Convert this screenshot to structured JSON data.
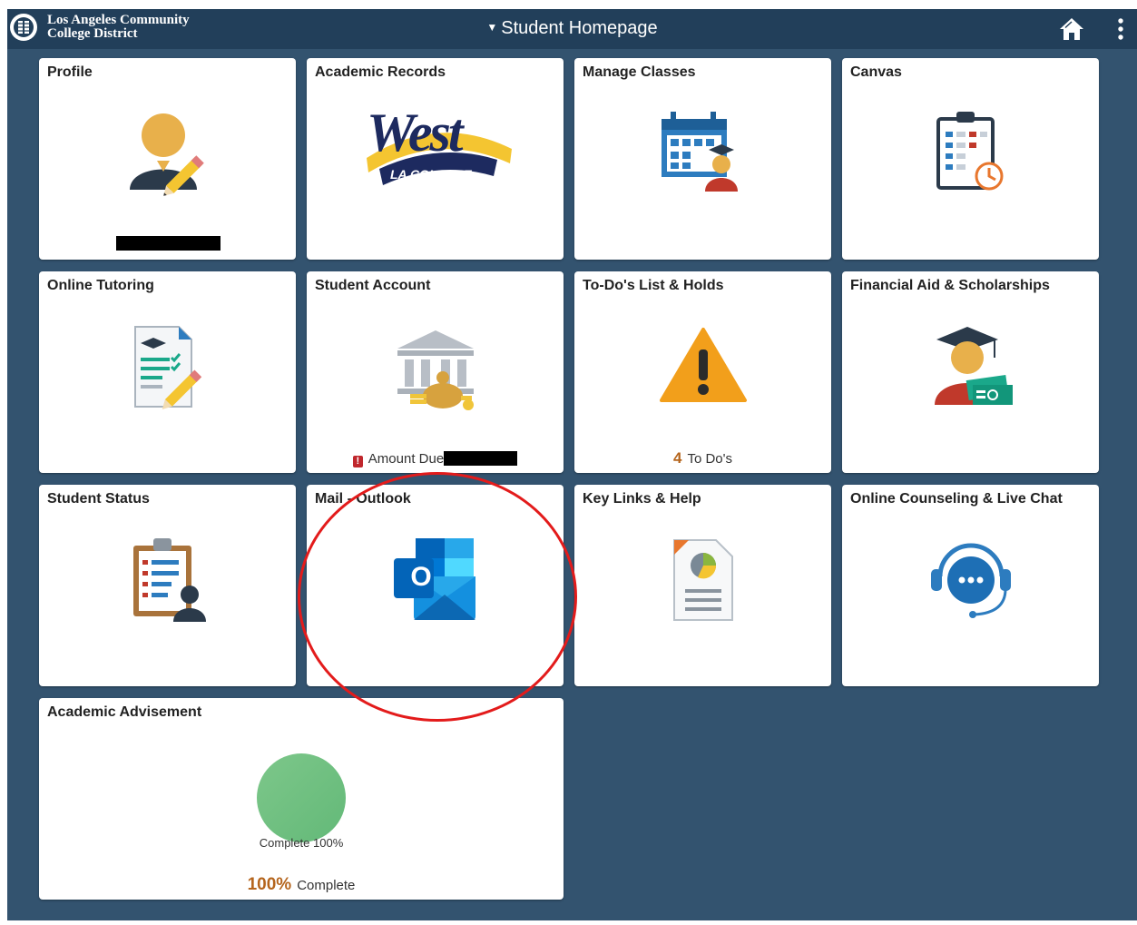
{
  "header": {
    "org_line1": "Los Angeles Community",
    "org_line2": "College District",
    "page_title": "Student Homepage",
    "icons": [
      "district-seal-icon",
      "caret-down-icon",
      "home-icon",
      "more-vertical-icon"
    ]
  },
  "tiles": [
    {
      "title": "Profile",
      "icon": "user-edit-icon"
    },
    {
      "title": "Academic Records",
      "logo_text_main": "West",
      "logo_text_sub": "LA COLLEGE"
    },
    {
      "title": "Manage Classes",
      "icon": "calendar-student-icon"
    },
    {
      "title": "Canvas",
      "icon": "clipboard-clock-icon"
    },
    {
      "title": "Online Tutoring",
      "icon": "document-pencil-icon"
    },
    {
      "title": "Student Account",
      "icon": "bank-money-icon",
      "footer_label": "Amount Due"
    },
    {
      "title": "To-Do's List & Holds",
      "icon": "warning-icon",
      "footer_count": "4",
      "footer_label": "To Do's"
    },
    {
      "title": "Financial Aid & Scholarships",
      "icon": "graduate-money-icon"
    },
    {
      "title": "Student Status",
      "icon": "clipboard-person-icon"
    },
    {
      "title": "Mail - Outlook",
      "icon": "outlook-icon",
      "icon_letter": "O"
    },
    {
      "title": "Key Links & Help",
      "icon": "report-chart-icon"
    },
    {
      "title": "Online Counseling & Live Chat",
      "icon": "headset-chat-icon"
    },
    {
      "title": "Academic Advisement",
      "icon": "progress-circle-icon",
      "progress": 1.0,
      "circle_label": "Complete 100%",
      "footer_pct": "100%",
      "footer_label": "Complete"
    }
  ],
  "colors": {
    "frame_bg": "#33536f",
    "topbar_bg": "#223f5a",
    "accent_orange": "#b5651d",
    "annotation_red": "#e31b1b"
  }
}
